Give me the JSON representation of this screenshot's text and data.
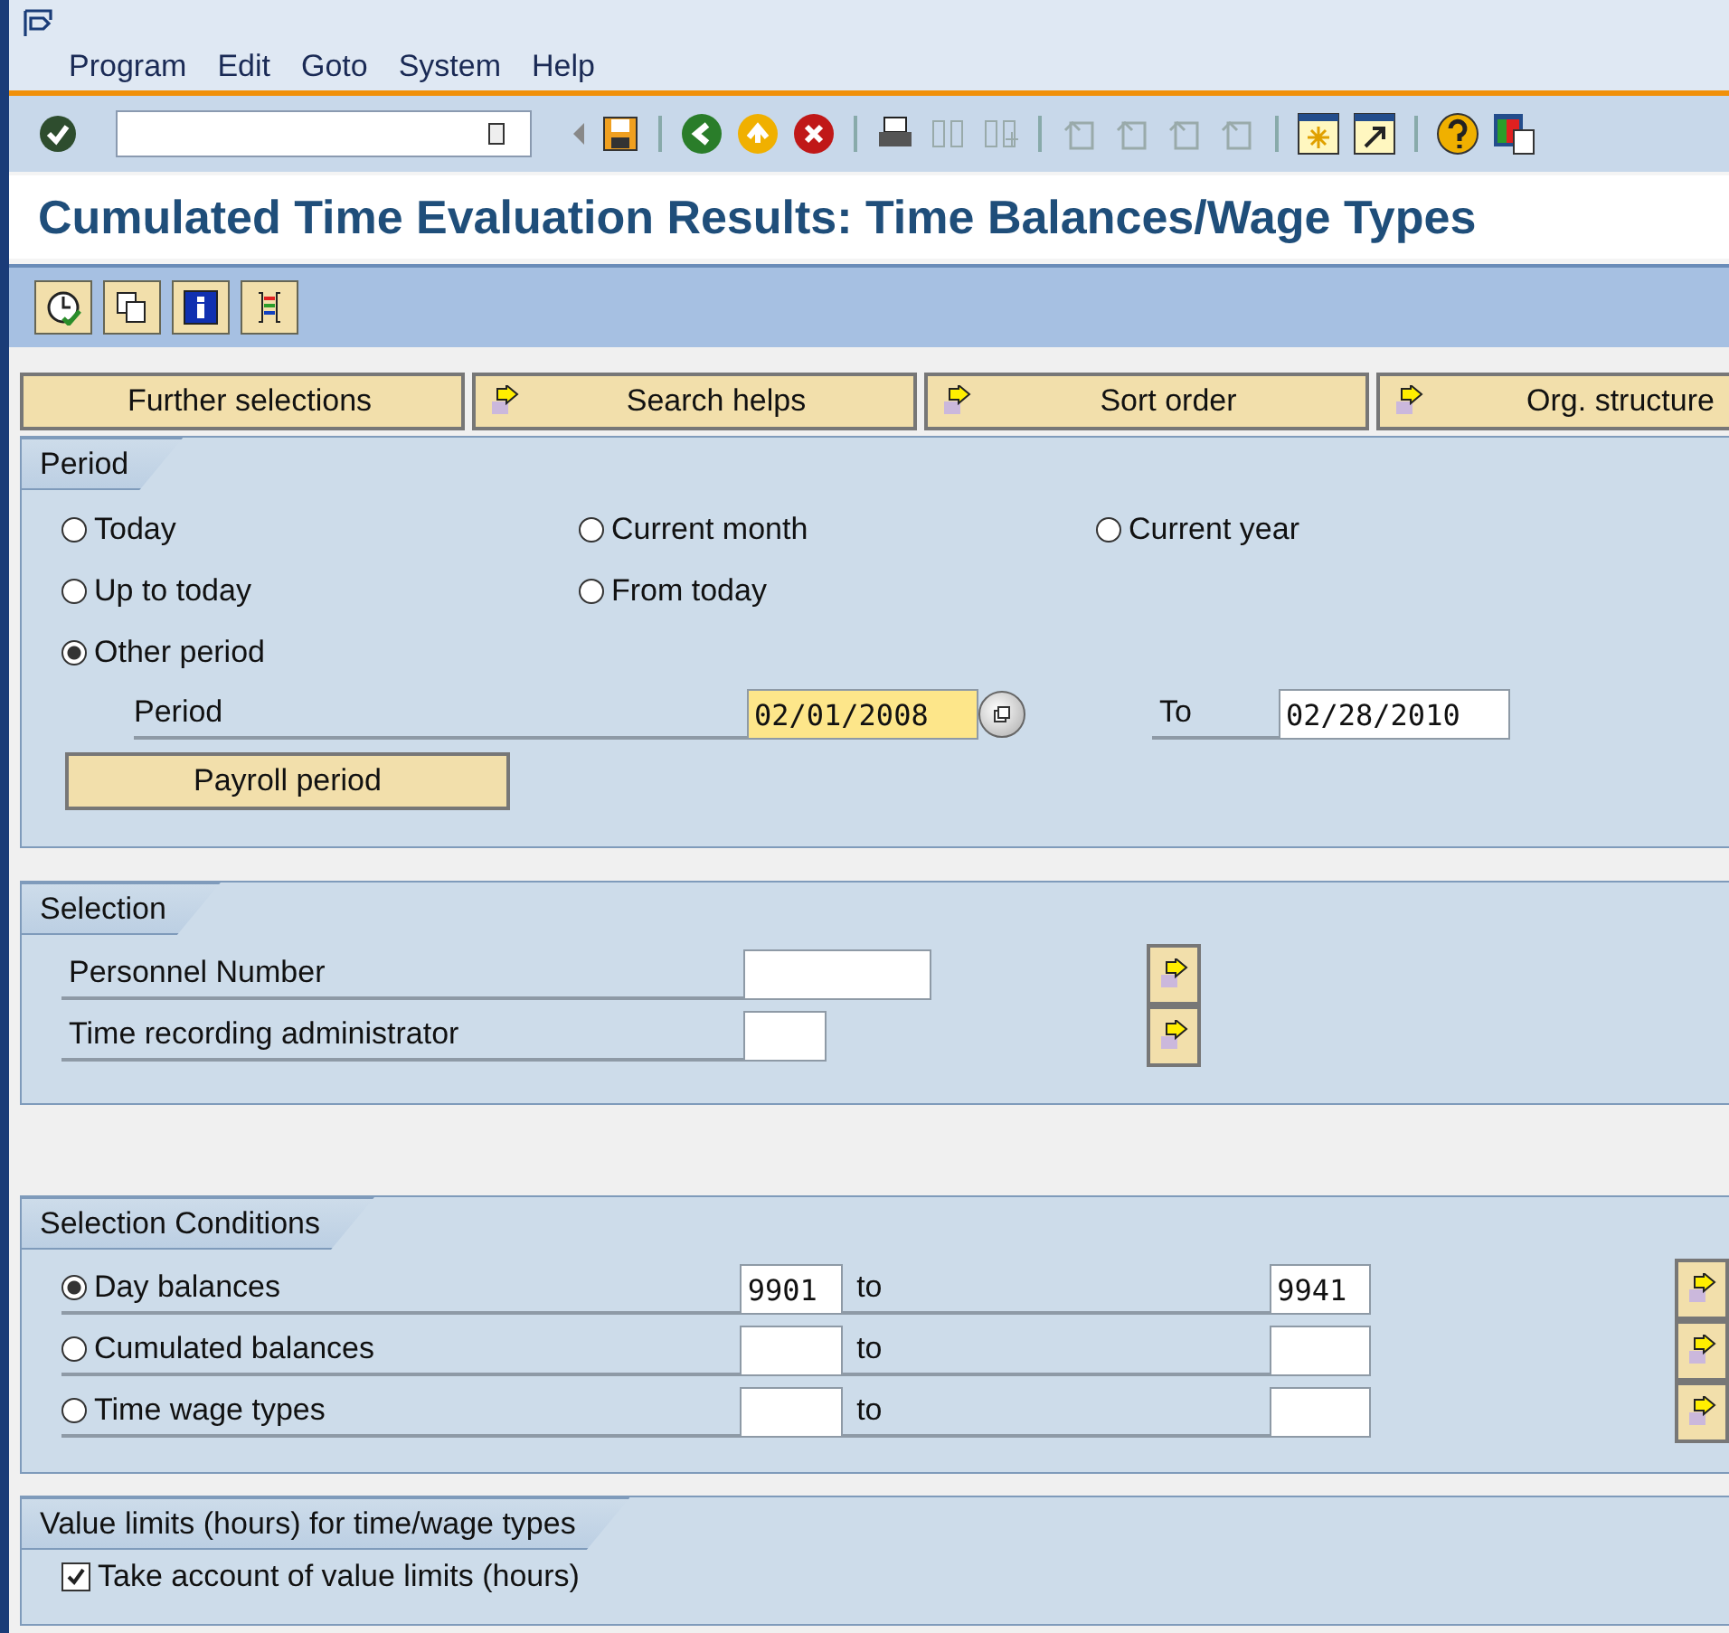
{
  "menu": [
    "Program",
    "Edit",
    "Goto",
    "System",
    "Help"
  ],
  "title": "Cumulated Time Evaluation Results: Time Balances/Wage Types",
  "tabs": [
    {
      "label": "Further selections",
      "kind": "plain"
    },
    {
      "label": "Search helps",
      "kind": "arrow"
    },
    {
      "label": "Sort order",
      "kind": "arrow"
    },
    {
      "label": "Org. structure",
      "kind": "arrow"
    }
  ],
  "period": {
    "heading": "Period",
    "option_rows": [
      [
        {
          "label": "Today",
          "selected": false
        },
        {
          "label": "Current month",
          "selected": false
        },
        {
          "label": "Current year",
          "selected": false
        }
      ],
      [
        {
          "label": "Up to today",
          "selected": false
        },
        {
          "label": "From today",
          "selected": false
        }
      ],
      [
        {
          "label": "Other period",
          "selected": true
        }
      ]
    ],
    "from_label": "Period",
    "from_value": "02/01/2008",
    "to_label": "To",
    "to_value": "02/28/2010",
    "payroll_button": "Payroll period"
  },
  "selection": {
    "heading": "Selection",
    "rows": [
      {
        "label": "Personnel Number"
      },
      {
        "label": "Time recording administrator"
      }
    ]
  },
  "conditions": {
    "heading": "Selection Conditions",
    "rows": [
      {
        "label": "Day balances",
        "selected": true,
        "from": "9901",
        "to_label": "to",
        "to": "9941"
      },
      {
        "label": "Cumulated balances",
        "selected": false,
        "to_label": "to"
      },
      {
        "label": "Time wage types",
        "selected": false,
        "to_label": "to"
      }
    ]
  },
  "limits": {
    "heading": "Value limits (hours) for time/wage types",
    "checkbox": {
      "label": "Take account of value limits (hours)",
      "checked": true
    }
  }
}
